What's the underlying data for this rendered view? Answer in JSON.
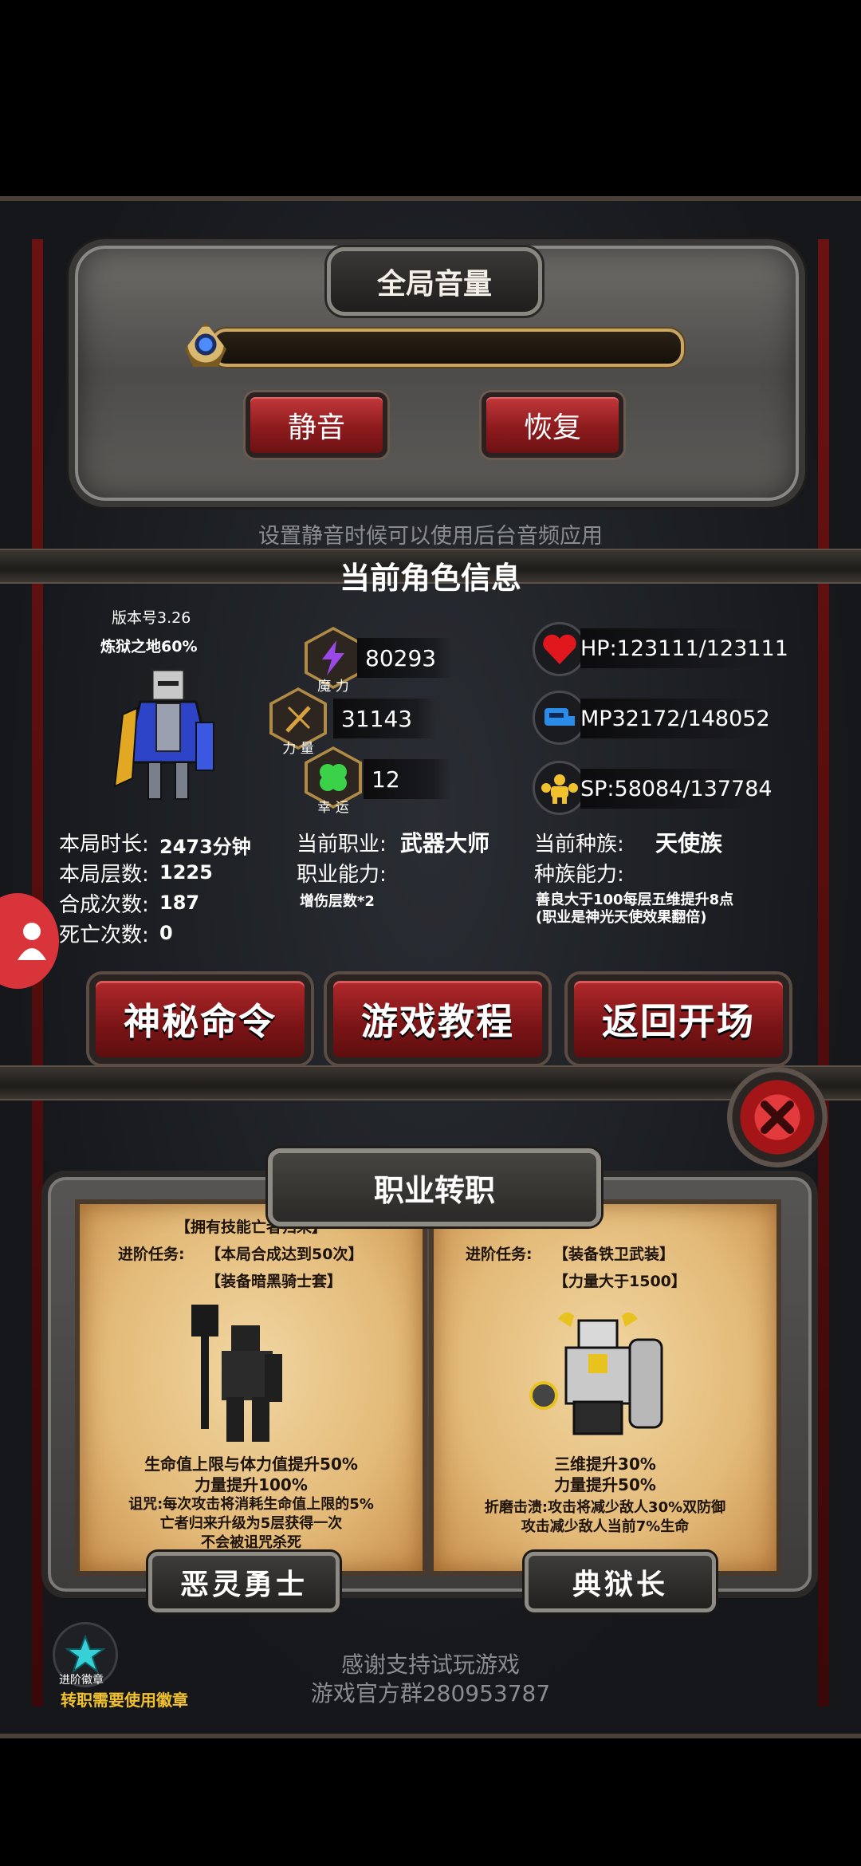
{
  "volume": {
    "title": "全局音量",
    "mute_label": "静音",
    "restore_label": "恢复",
    "hint": "设置静音时候可以使用后台音频应用",
    "level": 0
  },
  "character": {
    "section_title": "当前角色信息",
    "version": "版本号3.26",
    "difficulty": "炼狱之地60%",
    "attributes": [
      {
        "icon": "magic-icon",
        "caption": "魔 力",
        "value": "80293"
      },
      {
        "icon": "strength-icon",
        "caption": "力 量",
        "value": "31143"
      },
      {
        "icon": "clover-icon",
        "caption": "幸 运",
        "value": "12"
      }
    ],
    "hp": "HP:123111/123111",
    "mp": "MP32172/148052",
    "sp": "SP:58084/137784",
    "stats": [
      {
        "label": "本局时长:",
        "value": "2473分钟"
      },
      {
        "label": "本局层数:",
        "value": "1225"
      },
      {
        "label": "合成次数:",
        "value": "187"
      },
      {
        "label": "死亡次数:",
        "value": "0"
      }
    ],
    "job_label": "当前职业:",
    "job_value": "武器大师",
    "job_ability_label": "职业能力:",
    "job_ability_value": "增伤层数*2",
    "race_label": "当前种族:",
    "race_value": "天使族",
    "race_ability_label": "种族能力:",
    "race_ability_value": "善良大于100每层五维提升8点(职业是神光天使效果翻倍)"
  },
  "menu": {
    "secret_command": "神秘命令",
    "tutorial": "游戏教程",
    "back_to_start": "返回开场"
  },
  "class_change": {
    "title": "职业转职",
    "left": {
      "req1": "【拥有技能亡者归来】",
      "task_label": "进阶任务:",
      "req2": "【本局合成达到50次】",
      "req3": "【装备暗黑骑士套】",
      "effect1": "生命值上限与体力值提升50%",
      "effect2": "力量提升100%",
      "effect3": "诅咒:每次攻击将消耗生命值上限的5%",
      "effect4": "亡者归来升级为5层获得一次",
      "effect5": "不会被诅咒杀死",
      "name": "恶灵勇士"
    },
    "right": {
      "task_label": "进阶任务:",
      "req1": "【装备铁卫武装】",
      "req2": "【力量大于1500】",
      "effect1": "三维提升30%",
      "effect2": "力量提升50%",
      "effect3": "折磨击溃:攻击将减少敌人30%双防御",
      "effect4": "攻击减少敌人当前7%生命",
      "name": "典狱长"
    }
  },
  "footer": {
    "thanks": "感谢支持试玩游戏",
    "group": "游戏官方群280953787",
    "badge_caption": "进阶徽章",
    "badge_note": "转职需要使用徽章"
  }
}
